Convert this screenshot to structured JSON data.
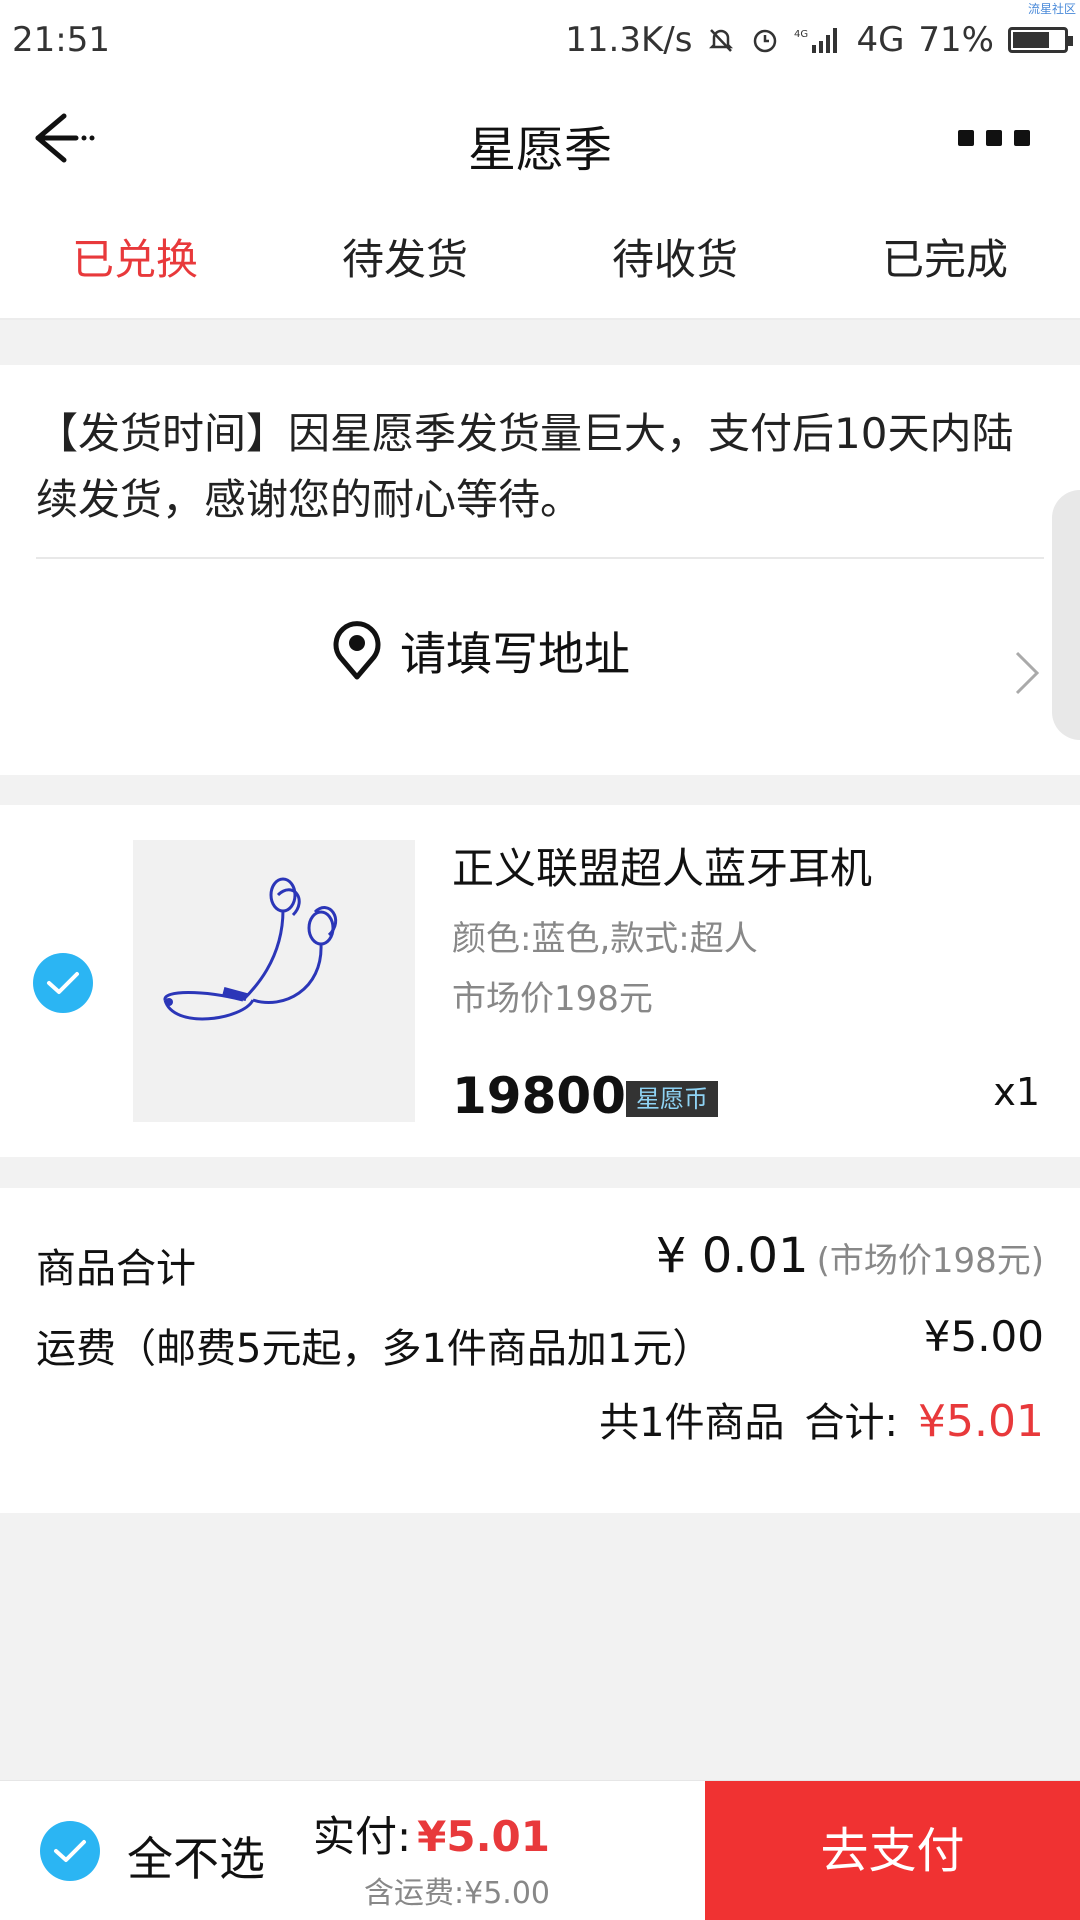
{
  "status_bar": {
    "time": "21:51",
    "net_speed": "11.3K/s",
    "network_type": "4G",
    "battery_text": "71%",
    "battery_level": 0.71,
    "watermark": "流星社区"
  },
  "navbar": {
    "title": "星愿季"
  },
  "tabs": [
    {
      "label": "已兑换",
      "active": true
    },
    {
      "label": "待发货",
      "active": false
    },
    {
      "label": "待收货",
      "active": false
    },
    {
      "label": "已完成",
      "active": false
    }
  ],
  "notice": {
    "text": "【发货时间】因星愿季发货量巨大，支付后10天内陆续发货，感谢您的耐心等待。"
  },
  "address": {
    "label": "请填写地址"
  },
  "product": {
    "name": "正义联盟超人蓝牙耳机",
    "attributes": "颜色:蓝色,款式:超人",
    "market_price": "市场价198元",
    "price": "19800",
    "currency_badge": "星愿币",
    "quantity": "x1",
    "checked": true
  },
  "summary": {
    "goods_total_label": "商品合计",
    "goods_total_value": "¥ 0.01",
    "goods_total_market": "(市场价198元)",
    "shipping_label": "运费（邮费5元起，多1件商品加1元）",
    "shipping_value": "¥5.00",
    "count_text": "共1件商品",
    "total_label": "合计:",
    "total_value": "¥5.01"
  },
  "bottom_bar": {
    "select_none_label": "全不选",
    "pay_label": "实付:",
    "pay_amount": "¥5.01",
    "shipping_included": "含运费:¥5.00",
    "pay_button": "去支付"
  },
  "colors": {
    "accent_red": "#e8393b",
    "check_blue": "#2bb5f3",
    "pay_button_red": "#f03232"
  }
}
